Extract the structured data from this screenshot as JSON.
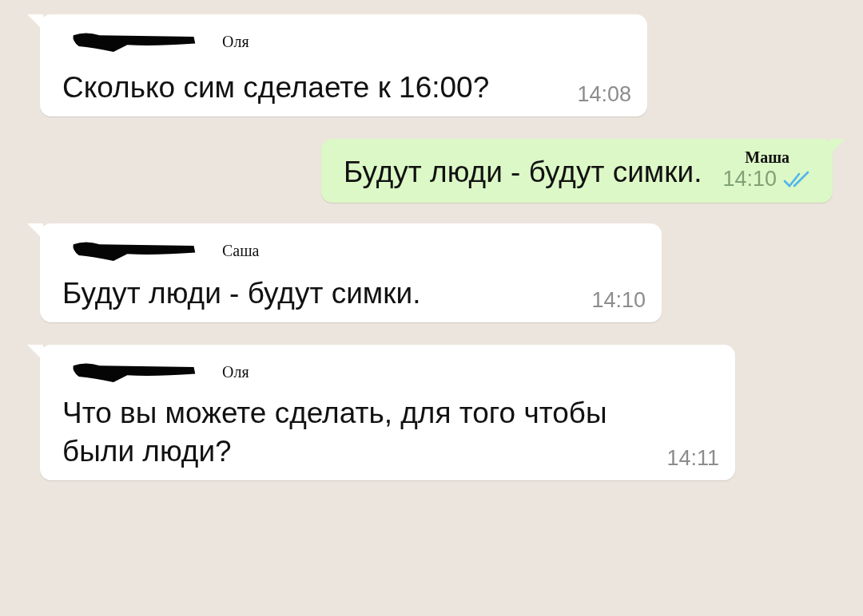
{
  "messages": [
    {
      "kind": "incoming",
      "sender": "Оля",
      "text": "Сколько сим сделаете к 16:00?",
      "time": "14:08"
    },
    {
      "kind": "outgoing",
      "sender": "Маша",
      "text": "Будут люди - будут симки.",
      "time": "14:10",
      "read": true
    },
    {
      "kind": "incoming",
      "sender": "Саша",
      "text": "Будут люди - будут симки.",
      "time": "14:10"
    },
    {
      "kind": "incoming",
      "sender": "Оля",
      "text": "Что вы можете сделать, для того чтобы были люди?",
      "time": "14:11"
    }
  ]
}
